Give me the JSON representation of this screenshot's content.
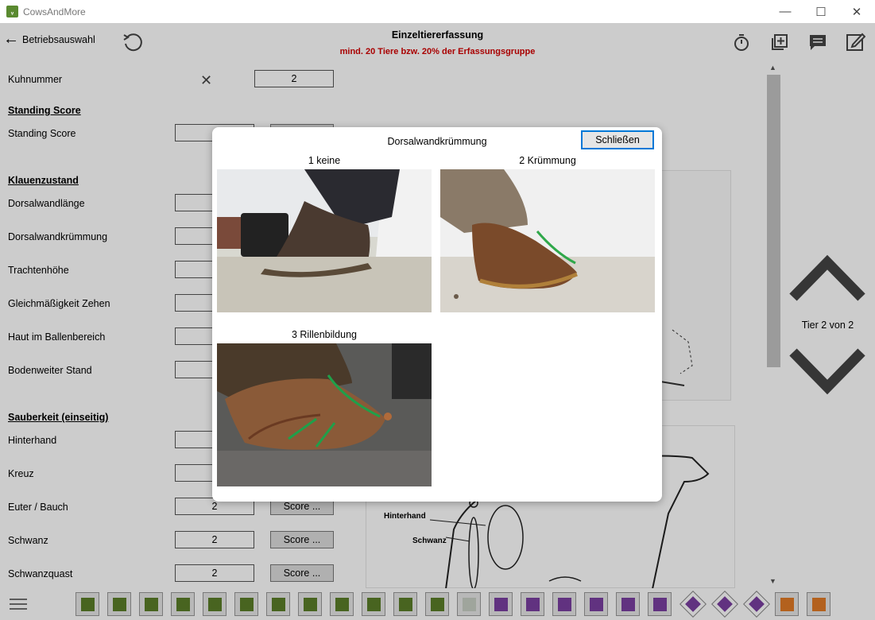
{
  "app": {
    "title": "CowsAndMore",
    "icon": "app-logo-icon"
  },
  "window_controls": {
    "minimize": "—",
    "maximize": "☐",
    "close": "✕"
  },
  "header": {
    "back_label": "Betriebsauswahl",
    "title": "Einzeltiererfassung",
    "subtitle": "mind. 20 Tiere bzw. 20% der Erfassungsgruppe",
    "subtitle_color": "#d40000",
    "icons": [
      "refresh-icon",
      "timer-icon",
      "add-copy-icon",
      "comment-icon",
      "edit-icon"
    ]
  },
  "form": {
    "kuhnummer_label": "Kuhnummer",
    "kuhnummer_value": "2",
    "sections": {
      "standing": "Standing Score",
      "klauen": "Klauenzustand",
      "sauberkeit": "Sauberkeit (einseitig)"
    },
    "standing_fields": [
      "Standing Score"
    ],
    "klauen_fields": [
      "Dorsalwandlänge",
      "Dorsalwandkrümmung",
      "Trachtenhöhe",
      "Gleichmäßigkeit Zehen",
      "Haut im Ballenbereich",
      "Bodenweiter Stand"
    ],
    "sauberkeit_fields": [
      {
        "label": "Hinterhand",
        "value": ""
      },
      {
        "label": "Kreuz",
        "value": ""
      },
      {
        "label": "Euter / Bauch",
        "value": "2"
      },
      {
        "label": "Schwanz",
        "value": "2"
      },
      {
        "label": "Schwanzquast",
        "value": "2"
      }
    ],
    "score_button": "Score ..."
  },
  "diagram_labels": {
    "hinterhand": "Hinterhand",
    "schwanz": "Schwanz"
  },
  "navigation": {
    "tier_label": "Tier 2 von 2"
  },
  "dialog": {
    "title": "Dorsalwandkrümmung",
    "close_button": "Schließen",
    "options": [
      {
        "caption": "1 keine"
      },
      {
        "caption": "2 Krümmung"
      },
      {
        "caption": "3 Rillenbildung"
      }
    ]
  },
  "bottom_bar": {
    "colors": {
      "green": "#5a7d28",
      "gray": "#c7cfc4",
      "purple": "#7a3fa0",
      "orange": "#e07a26"
    },
    "squares": [
      "green",
      "green",
      "green",
      "green",
      "green",
      "green",
      "green",
      "green",
      "green",
      "green",
      "green",
      "green",
      "gray",
      "purple",
      "purple",
      "purple",
      "purple",
      "purple",
      "purple"
    ],
    "diamonds": [
      "purple",
      "purple",
      "purple"
    ],
    "end_squares": [
      "orange",
      "orange"
    ]
  }
}
